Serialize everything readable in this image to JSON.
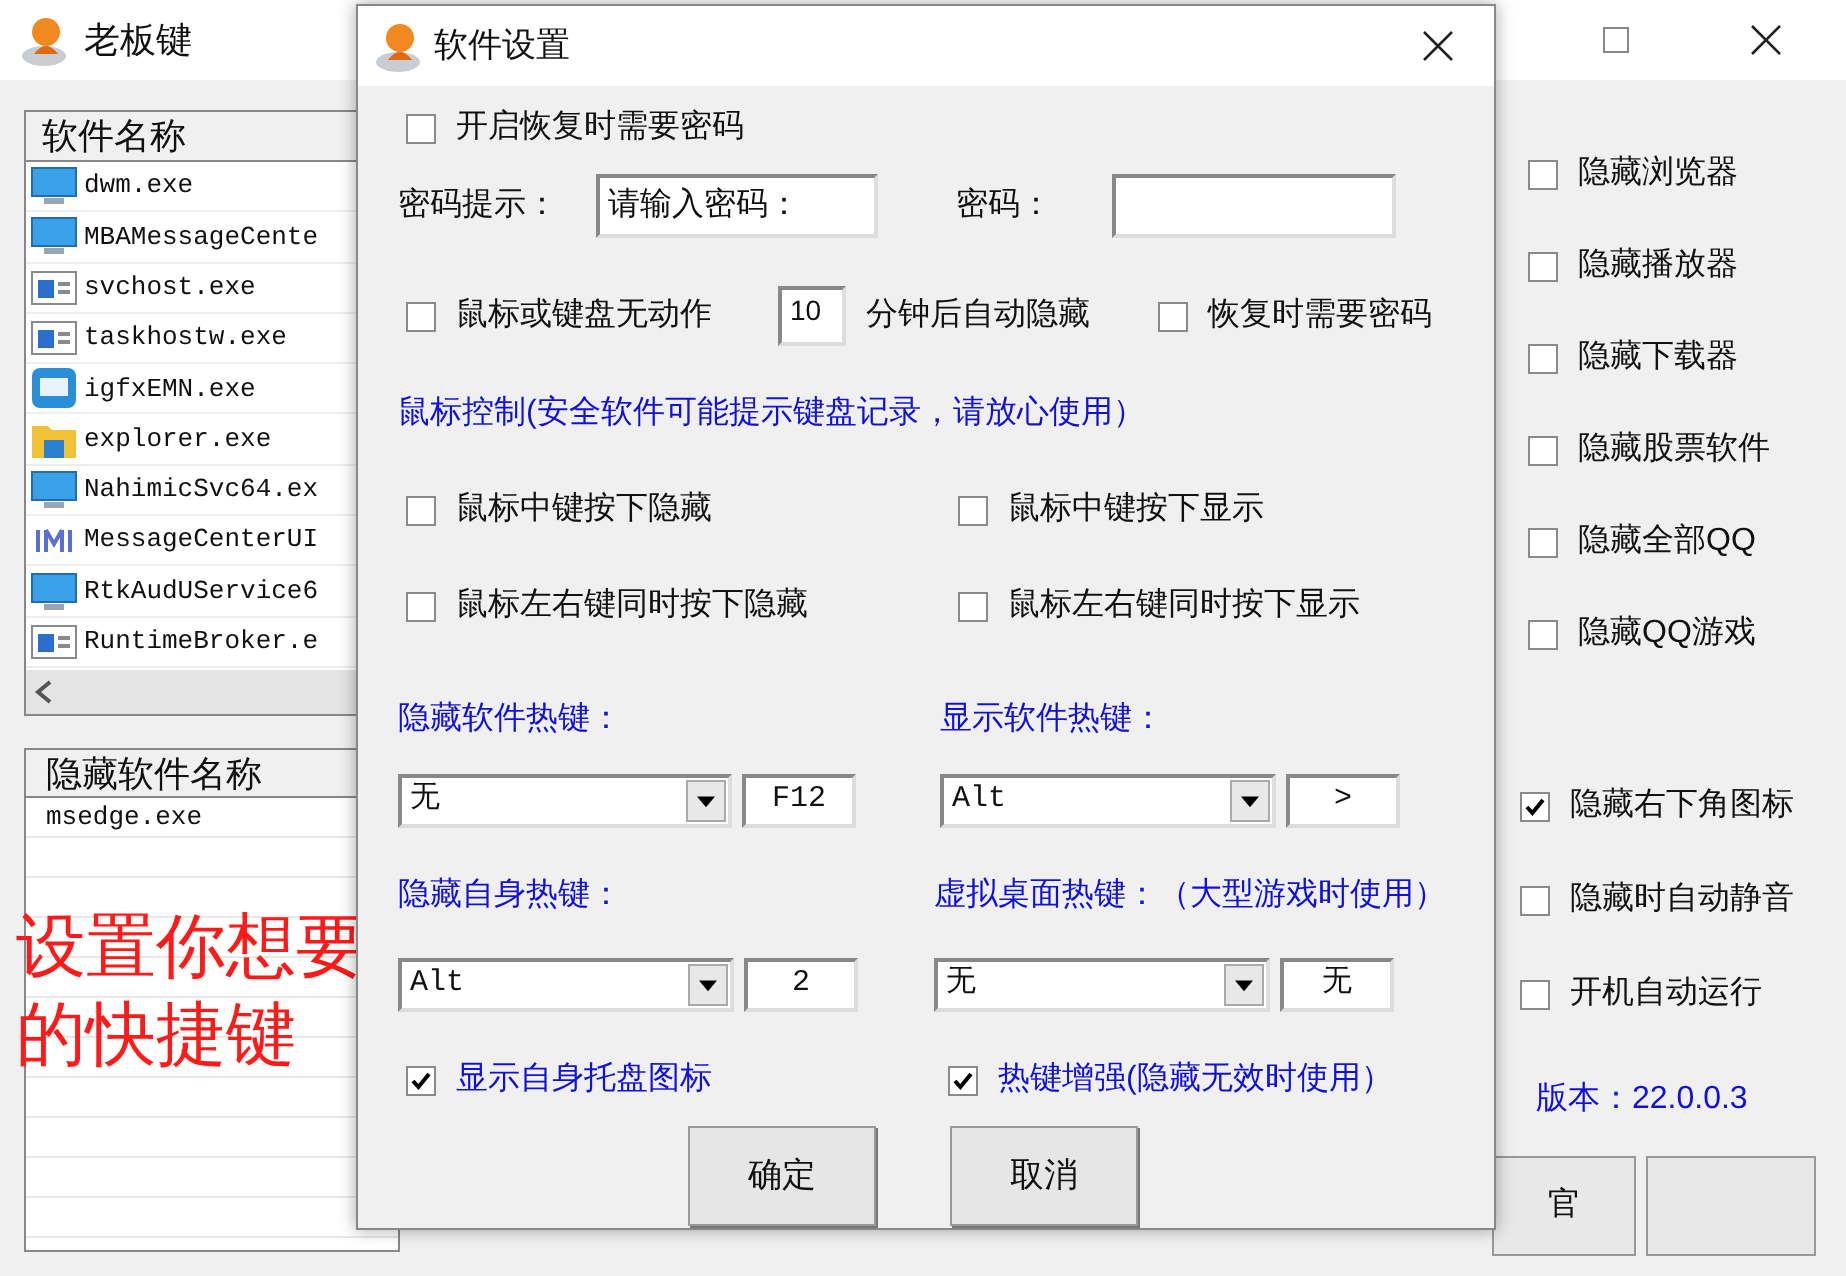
{
  "main_window": {
    "title": "老板键",
    "software_list": {
      "header": "软件名称",
      "rows": [
        {
          "name": "dwm.exe",
          "kind": "monitor"
        },
        {
          "name": "MBAMessageCente",
          "kind": "monitor"
        },
        {
          "name": "svchost.exe",
          "kind": "window"
        },
        {
          "name": "taskhostw.exe",
          "kind": "window"
        },
        {
          "name": "igfxEMN.exe",
          "kind": "app"
        },
        {
          "name": "explorer.exe",
          "kind": "folder"
        },
        {
          "name": "NahimicSvc64.ex",
          "kind": "monitor"
        },
        {
          "name": "MessageCenterUI",
          "kind": "bars"
        },
        {
          "name": "RtkAudUService6",
          "kind": "monitor"
        },
        {
          "name": "RuntimeBroker.e",
          "kind": "window"
        }
      ]
    },
    "hidden_list": {
      "header": "隐藏软件名称",
      "rows": [
        "msedge.exe"
      ]
    },
    "annotation": "设置你想要的快捷键",
    "options": [
      {
        "label": "隐藏浏览器",
        "checked": false
      },
      {
        "label": "隐藏播放器",
        "checked": false
      },
      {
        "label": "隐藏下载器",
        "checked": false
      },
      {
        "label": "隐藏股票软件",
        "checked": false
      },
      {
        "label": "隐藏全部QQ",
        "checked": false
      },
      {
        "label": "隐藏QQ游戏",
        "checked": false
      }
    ],
    "options_2": [
      {
        "label": "隐藏右下角图标",
        "checked": true
      },
      {
        "label": "隐藏时自动静音",
        "checked": false
      },
      {
        "label": "开机自动运行",
        "checked": false
      }
    ],
    "version": "版本：22.0.0.3",
    "buttons": [
      "官"
    ]
  },
  "dialog": {
    "title": "软件设置",
    "restore_password": {
      "label": "开启恢复时需要密码",
      "checked": false
    },
    "password_hint": {
      "label": "密码提示：",
      "value": "请输入密码："
    },
    "password": {
      "label": "密码："
    },
    "idle_hide": {
      "checkbox": {
        "label": "鼠标或键盘无动作",
        "checked": false
      },
      "minutes": "10",
      "suffix": "分钟后自动隐藏",
      "restore_password": {
        "label": "恢复时需要密码",
        "checked": false
      }
    },
    "mouse_control_note": "鼠标控制(安全软件可能提示键盘记录，请放心使用）",
    "mouse_options": [
      {
        "label": "鼠标中键按下隐藏",
        "checked": false
      },
      {
        "label": "鼠标中键按下显示",
        "checked": false
      },
      {
        "label": "鼠标左右键同时按下隐藏",
        "checked": false
      },
      {
        "label": "鼠标左右键同时按下显示",
        "checked": false
      }
    ],
    "hotkeys": [
      {
        "label": "隐藏软件热键：",
        "modifier": "无",
        "key": "F12"
      },
      {
        "label": "显示软件热键：",
        "modifier": "Alt",
        "key": ">"
      },
      {
        "label": "隐藏自身热键：",
        "modifier": "Alt",
        "key": "2"
      },
      {
        "label": "虚拟桌面热键：（大型游戏时使用）",
        "modifier": "无",
        "key": "无"
      }
    ],
    "bottom_options": [
      {
        "label": "显示自身托盘图标",
        "checked": true
      },
      {
        "label": "热键增强(隐藏无效时使用）",
        "checked": true
      }
    ],
    "buttons": [
      "确定",
      "取消"
    ]
  }
}
